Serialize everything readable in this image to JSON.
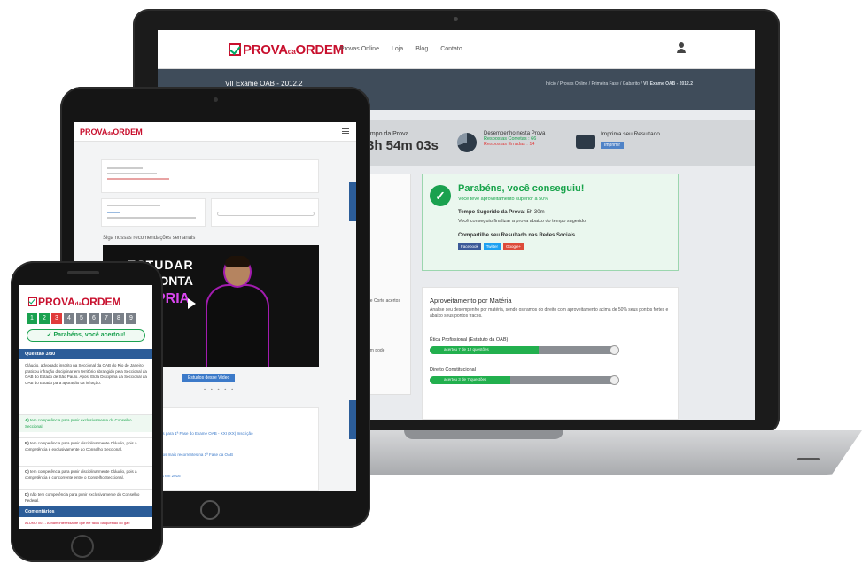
{
  "laptop": {
    "logo_main": "PROVA",
    "logo_small": "da",
    "logo_end": "ORDEM",
    "nav": [
      "Provas Online",
      "Loja",
      "Blog",
      "Contato"
    ],
    "banner_title": "VII Exame OAB - 2012.2",
    "breadcrumb_plain": "Início / Provas Online / Primeira Fase / Gabarito / ",
    "breadcrumb_current": "VII Exame OAB - 2012.2",
    "tempo_label": "empo da Prova",
    "tempo_value": "3h 54m 03s",
    "desempenho_label": "Desempenho nesta Prova",
    "respostas_corretas": "Respostas Corretas : 66",
    "respostas_erradas": "Respostas Erradas : 14",
    "imprima_label": "Imprima seu Resultado",
    "imprimir_btn": "Imprimir",
    "success_title": "Parabéns, você conseguiu!",
    "success_sub": "Você teve aproveitamento superior a 50%",
    "tempo_sugerido_label": "Tempo Sugerido da Prova:",
    "tempo_sugerido_value": " 5h 30m",
    "tempo_sugerido_sub": "Você conseguiu finalizar a prova abaixo do tempo sugerido.",
    "compartilhe": "Compartilhe seu Resultado nas Redes Sociais",
    "share_facebook": "Facebook",
    "share_twitter": "Twitter",
    "share_google": "Google+",
    "materia_title": "Aproveitamento por Matéria",
    "materia_desc": "Analise seu desempenho por matéria, sendo os ramos do direito com aproveitamento acima de 50% seus pontos fortes e abaixo seus pontos fracos.",
    "subjects": [
      {
        "name": "Ética Profissional (Estatuto da OAB)",
        "label": "acertou 7 de 12 questões",
        "progress": 0.58
      },
      {
        "name": "Direito Constitucional",
        "label": "acertou 3 de 7 questões",
        "progress": 0.43
      }
    ],
    "left_panel_text": "de Corte acertos",
    "left_panel_text2": "em pode"
  },
  "tablet": {
    "logo_main": "PROVA",
    "logo_small": "da",
    "logo_end": "ORDEM",
    "recommend": "Siga nossas recomendações semanais",
    "video_line1": "ESTUDAR",
    "video_line2": "PONTA",
    "video_line3": "PRIA",
    "video_btn": "Estudos desse Vídeo",
    "dots": "• • • • •",
    "news": [
      {
        "date": "26/11/16",
        "text": "Gabarito de Questões para 1ª Fase do Exame OAB - XXI (XX) Inscrição"
      },
      {
        "date": "26/11/16",
        "text": "Aprenda com Resumos mais recorrentes na 1ª Fase da OAB"
      },
      {
        "date": "26/11/16",
        "text": "Calendário de Provas em 2016"
      }
    ]
  },
  "phone": {
    "logo_main": "PROVA",
    "logo_small": "da",
    "logo_end": "ORDEM",
    "numbers": [
      "1",
      "2",
      "3",
      "4",
      "5",
      "6",
      "7",
      "8",
      "9"
    ],
    "success": "Parabéns, você acertou!",
    "question_header": "Questão 3/80",
    "question_text": "Cláudio, advogado inscrito na Seccional da OAB do Rio de Janeiro, praticou infração disciplinar em território abrangido pela Seccional da OAB do Estado de São Paulo. Após, Eliza Disciplina da Seccional da OAB do Estado para apuração da infração.",
    "options": [
      {
        "letter": "A)",
        "text": " tem competência para punir exclusivamente do Conselho Seccional."
      },
      {
        "letter": "B)",
        "text": " tem competência para punir disciplinarmente Cláudio, pois a competência é exclusivamente do Conselho Seccional."
      },
      {
        "letter": "C)",
        "text": " tem competência para punir disciplinarmente Cláudio, pois a competência é concorrente entre o Conselho Seccional."
      },
      {
        "letter": "D)",
        "text": " não tem competência para punir exclusivamente do Conselho Federal."
      }
    ],
    "comments_header": "Comentários",
    "comment_line": "ALUNO 001 - Acham interessante que ele falou da questão do gab"
  }
}
